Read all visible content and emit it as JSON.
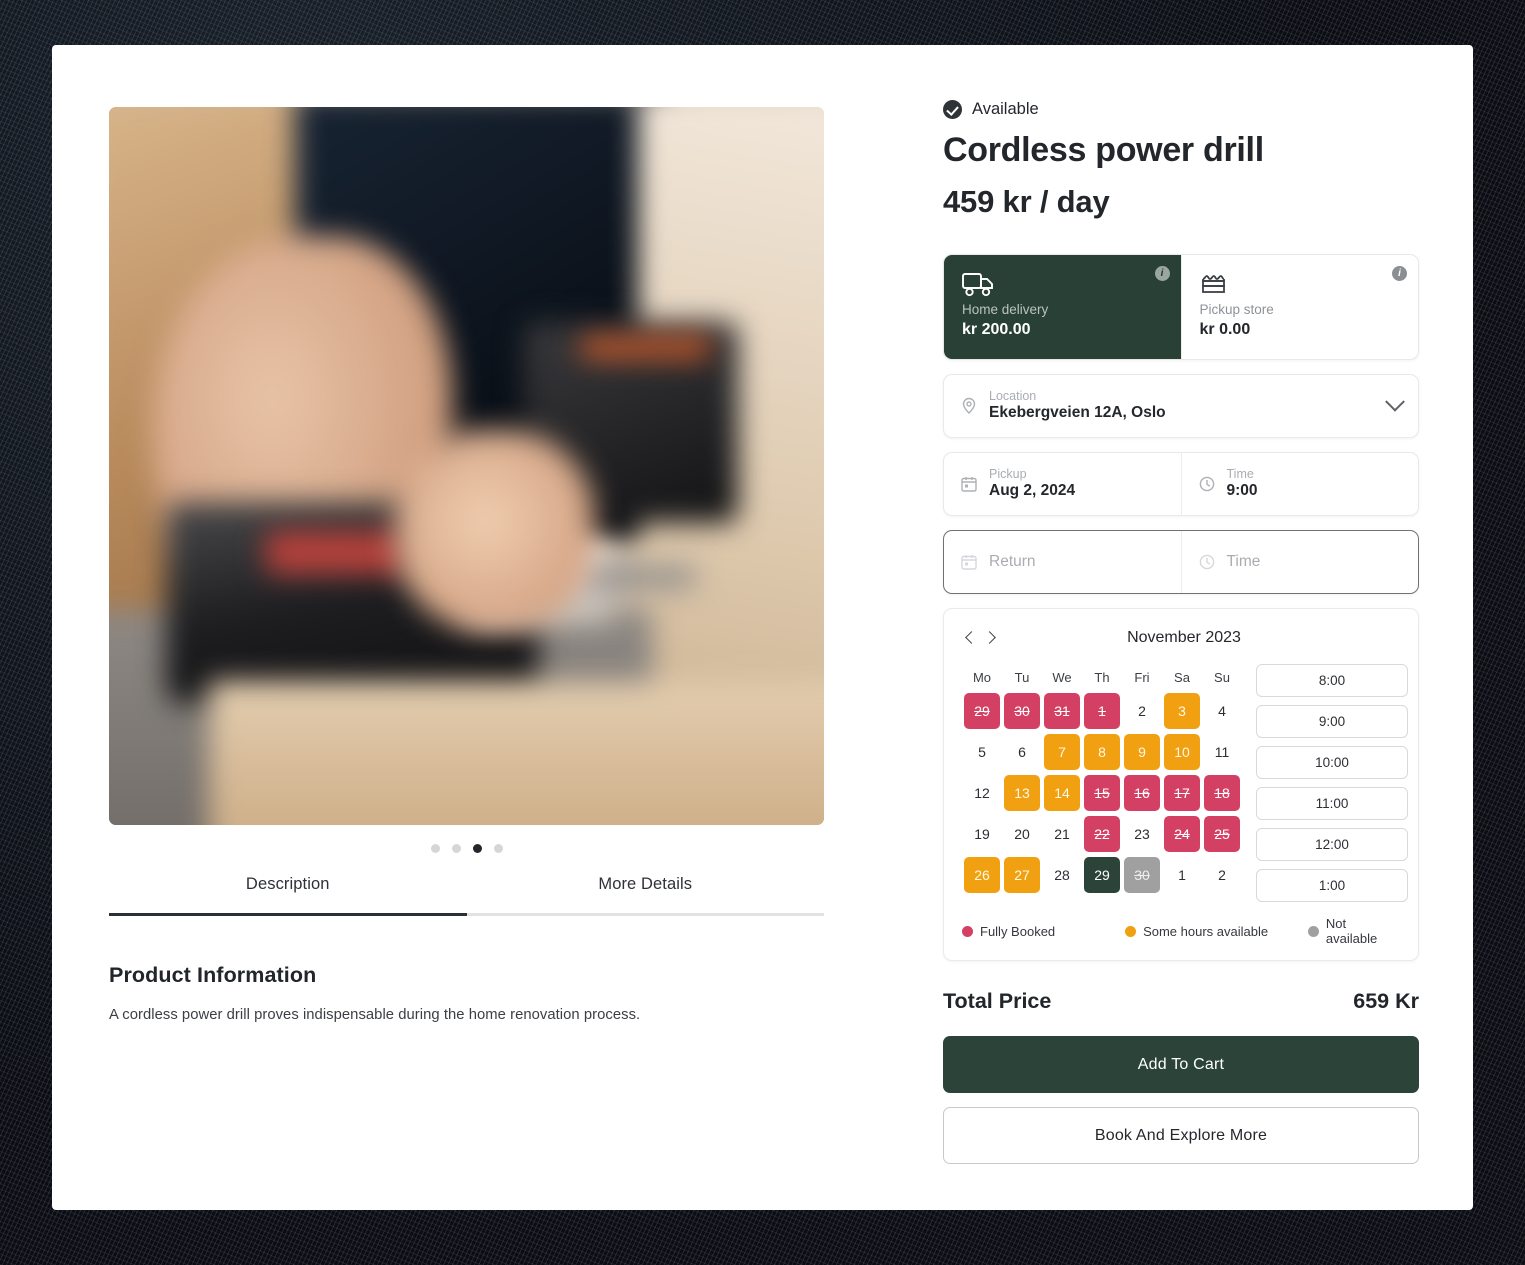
{
  "product": {
    "availability": "Available",
    "title": "Cordless power drill",
    "price": "459 kr / day",
    "info_title": "Product Information",
    "info_body": "A cordless power drill proves indispensable during the home renovation process."
  },
  "tabs": [
    {
      "label": "Description",
      "active": true
    },
    {
      "label": "More Details",
      "active": false
    }
  ],
  "gallery": {
    "dots": 4,
    "active_index": 2
  },
  "delivery": {
    "options": [
      {
        "name": "home-delivery",
        "label": "Home delivery",
        "value": "kr 200.00",
        "selected": true,
        "icon": "truck-icon",
        "badge": "i"
      },
      {
        "name": "pickup-store",
        "label": "Pickup store",
        "value": "kr 0.00",
        "selected": false,
        "icon": "store-icon",
        "badge": "i"
      }
    ]
  },
  "fields": {
    "location": {
      "label": "Location",
      "value": "Ekebergveien 12A, Oslo",
      "icon": "map-pin-icon"
    },
    "pickup_date": {
      "label": "Pickup",
      "value": "Aug 2, 2024",
      "icon": "calendar-icon"
    },
    "pickup_time": {
      "label": "Time",
      "value": "9:00",
      "icon": "clock-icon"
    },
    "return_date": {
      "label": "Return",
      "placeholder": "Return",
      "value": "",
      "icon": "calendar-icon"
    },
    "return_time": {
      "label": "Time",
      "placeholder": "Time",
      "value": "",
      "icon": "clock-icon"
    }
  },
  "calendar": {
    "month_label": "November 2023",
    "prev_label": "Previous month",
    "next_label": "Next month",
    "weekdays": [
      "Mo",
      "Tu",
      "We",
      "Th",
      "Fri",
      "Sa",
      "Su"
    ],
    "weeks": [
      [
        {
          "d": "29",
          "state": "booked"
        },
        {
          "d": "30",
          "state": "booked"
        },
        {
          "d": "31",
          "state": "booked"
        },
        {
          "d": "1",
          "state": "booked"
        },
        {
          "d": "2",
          "state": "free"
        },
        {
          "d": "3",
          "state": "partial"
        },
        {
          "d": "4",
          "state": "free"
        }
      ],
      [
        {
          "d": "5",
          "state": "free"
        },
        {
          "d": "6",
          "state": "free"
        },
        {
          "d": "7",
          "state": "partial"
        },
        {
          "d": "8",
          "state": "partial"
        },
        {
          "d": "9",
          "state": "partial"
        },
        {
          "d": "10",
          "state": "partial"
        },
        {
          "d": "11",
          "state": "free"
        }
      ],
      [
        {
          "d": "12",
          "state": "free"
        },
        {
          "d": "13",
          "state": "partial"
        },
        {
          "d": "14",
          "state": "partial"
        },
        {
          "d": "15",
          "state": "booked"
        },
        {
          "d": "16",
          "state": "booked"
        },
        {
          "d": "17",
          "state": "booked"
        },
        {
          "d": "18",
          "state": "booked"
        }
      ],
      [
        {
          "d": "19",
          "state": "free"
        },
        {
          "d": "20",
          "state": "free"
        },
        {
          "d": "21",
          "state": "free"
        },
        {
          "d": "22",
          "state": "booked"
        },
        {
          "d": "23",
          "state": "free"
        },
        {
          "d": "24",
          "state": "booked"
        },
        {
          "d": "25",
          "state": "booked"
        }
      ],
      [
        {
          "d": "26",
          "state": "partial"
        },
        {
          "d": "27",
          "state": "partial"
        },
        {
          "d": "28",
          "state": "free"
        },
        {
          "d": "29",
          "state": "selected"
        },
        {
          "d": "30",
          "state": "off"
        },
        {
          "d": "1",
          "state": "free"
        },
        {
          "d": "2",
          "state": "free"
        }
      ]
    ],
    "time_slots": [
      "8:00",
      "9:00",
      "10:00",
      "11:00",
      "12:00",
      "1:00"
    ],
    "legend": [
      {
        "label": "Fully Booked",
        "color": "#d44063"
      },
      {
        "label": "Some hours available",
        "color": "#f0a010"
      },
      {
        "label": "Not available",
        "color": "#a0a0a0"
      }
    ]
  },
  "summary": {
    "total_label": "Total Price",
    "total_value": "659 Kr",
    "primary_button": "Add To Cart",
    "secondary_button": "Book And Explore More"
  },
  "colors": {
    "brand_green": "#2b4339",
    "booked": "#d44063",
    "partial": "#f0a010",
    "off": "#a0a0a0"
  }
}
